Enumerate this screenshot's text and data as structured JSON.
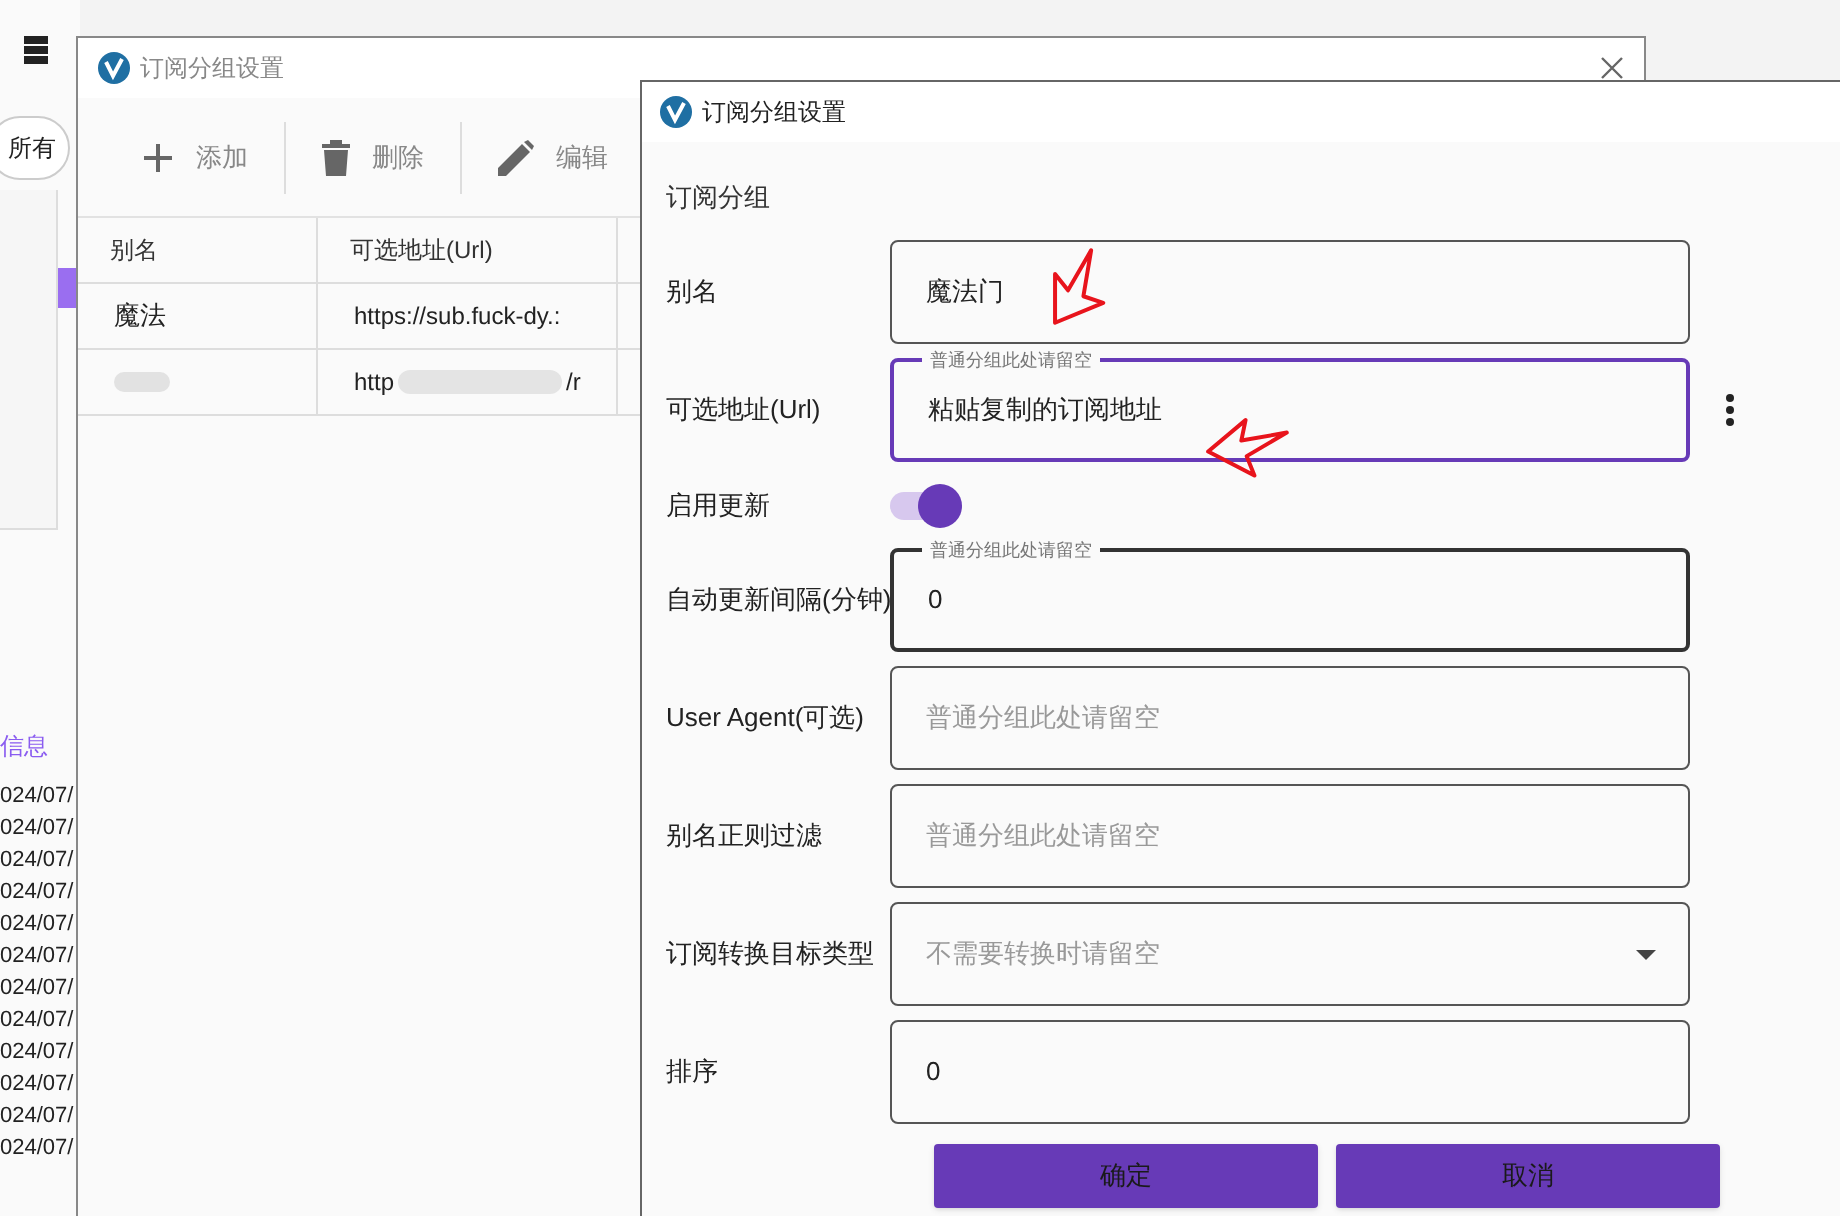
{
  "background_app": {
    "filter_chip": "所有",
    "tab_label": "信息",
    "log_rows": [
      "024/07/",
      "024/07/",
      "024/07/",
      "024/07/",
      "024/07/",
      "024/07/",
      "024/07/",
      "024/07/",
      "024/07/",
      "024/07/",
      "024/07/",
      "024/07/"
    ]
  },
  "list_window": {
    "title": "订阅分组设置",
    "toolbar": [
      {
        "kind": "add",
        "label": "添加"
      },
      {
        "kind": "delete",
        "label": "删除"
      },
      {
        "kind": "edit",
        "label": "编辑"
      }
    ],
    "table": {
      "columns": [
        "别名",
        "可选地址(Url)"
      ],
      "rows": [
        {
          "alias": "魔法",
          "url_parts": [
            "https://sub.fuck-dy.:"
          ],
          "blurred": false
        },
        {
          "alias": "",
          "url_parts": [
            "http",
            "/r"
          ],
          "blurred": true
        }
      ]
    }
  },
  "edit_window": {
    "title": "订阅分组设置",
    "section": "订阅分组",
    "fields": [
      {
        "kind": "text",
        "label": "别名",
        "value": "魔法门",
        "focused": false,
        "annotated": true
      },
      {
        "kind": "text",
        "label": "可选地址(Url)",
        "floating_label": "普通分组此处请留空",
        "value": "粘贴复制的订阅地址",
        "focused": true,
        "annotated": true,
        "menu": true
      },
      {
        "kind": "toggle",
        "label": "启用更新",
        "on": true
      },
      {
        "kind": "text",
        "label": "自动更新间隔(分钟)",
        "floating_label": "普通分组此处请留空",
        "value": "0",
        "focused": false,
        "hovered": true
      },
      {
        "kind": "text",
        "label": "User Agent(可选)",
        "placeholder": "普通分组此处请留空",
        "focused": false
      },
      {
        "kind": "text",
        "label": "别名正则过滤",
        "placeholder": "普通分组此处请留空",
        "focused": false
      },
      {
        "kind": "select",
        "label": "订阅转换目标类型",
        "placeholder": "不需要转换时请留空",
        "focused": false
      },
      {
        "kind": "text",
        "label": "排序",
        "value": "0",
        "focused": false
      }
    ],
    "buttons": [
      "确定",
      "取消"
    ]
  }
}
